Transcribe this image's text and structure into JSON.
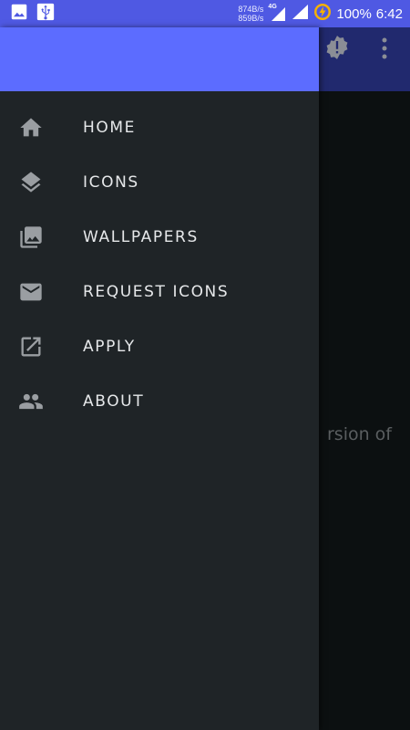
{
  "status_bar": {
    "upload_speed": "874B/s",
    "download_speed": "859B/s",
    "network_type": "4G",
    "battery": "100%",
    "time": "6:42",
    "icons": [
      "gallery-icon",
      "usb-icon",
      "signal-icon",
      "wifi-icon",
      "battery-charging-icon"
    ]
  },
  "toolbar": {
    "icons": [
      "alert-badge-icon",
      "more-vert-icon"
    ]
  },
  "background": {
    "partial_text": "rsion of"
  },
  "drawer": {
    "items": [
      {
        "label": "HOME",
        "icon": "home-icon"
      },
      {
        "label": "ICONS",
        "icon": "layers-icon"
      },
      {
        "label": "WALLPAPERS",
        "icon": "photo-library-icon"
      },
      {
        "label": "REQUEST ICONS",
        "icon": "email-icon"
      },
      {
        "label": "APPLY",
        "icon": "open-in-new-icon"
      },
      {
        "label": "ABOUT",
        "icon": "people-icon"
      }
    ]
  },
  "colors": {
    "status_bar": "#4f59e3",
    "drawer_header": "#5c6cff",
    "drawer_bg": "#1f2427",
    "toolbar_bg": "#21296e",
    "icon_color": "#9a9ea2",
    "label_color": "#e6e8ea"
  }
}
